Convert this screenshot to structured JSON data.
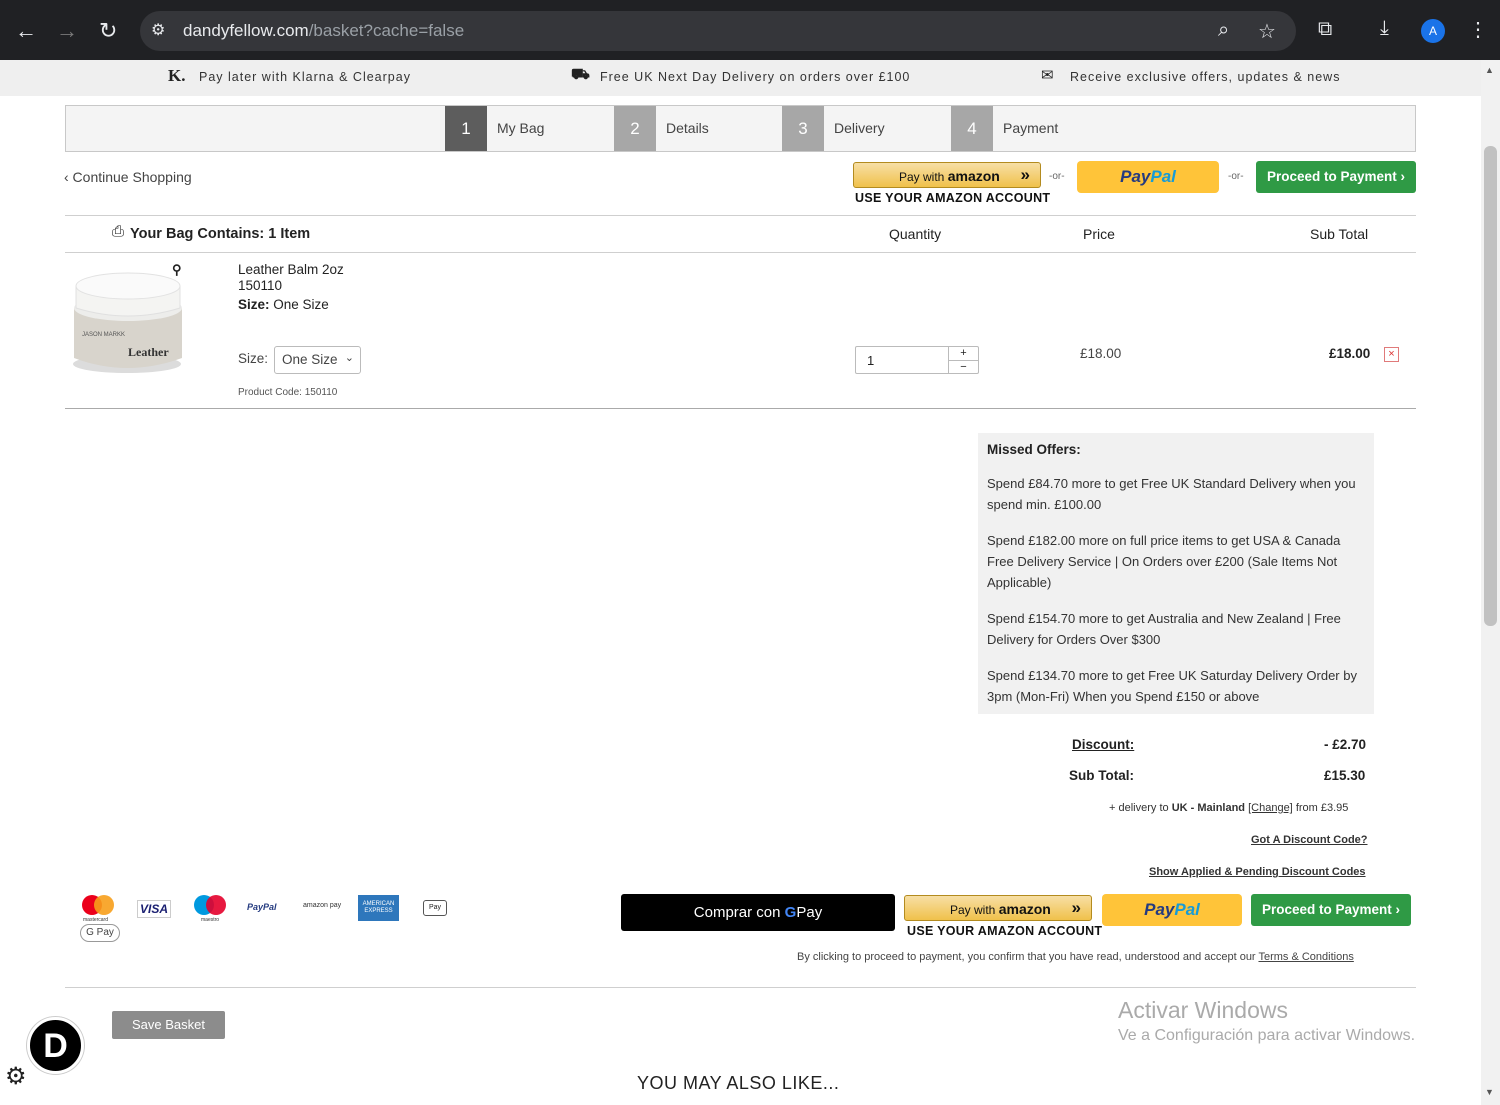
{
  "browser": {
    "url_host": "dandyfellow.com",
    "url_path": "/basket?cache=false",
    "profile_initial": "A"
  },
  "promo": {
    "klarna": "Pay later with Klarna & Clearpay",
    "klarna_icon": "K.",
    "delivery": "Free UK Next Day Delivery on orders over £100",
    "offers": "Receive exclusive offers, updates & news"
  },
  "steps": [
    {
      "num": "1",
      "label": "My Bag"
    },
    {
      "num": "2",
      "label": "Details"
    },
    {
      "num": "3",
      "label": "Delivery"
    },
    {
      "num": "4",
      "label": "Payment"
    }
  ],
  "top_actions": {
    "continue": "‹ Continue Shopping",
    "amazon_pay": "Pay with",
    "amazon_word": "amazon",
    "amazon_sub": "USE YOUR AMAZON ACCOUNT",
    "or": "-or-",
    "paypal_a": "Pay",
    "paypal_b": "Pal",
    "proceed": "Proceed to Payment ›"
  },
  "table": {
    "bag_contains": "Your Bag Contains: 1 Item",
    "quantity": "Quantity",
    "price": "Price",
    "subtotal": "Sub Total"
  },
  "product": {
    "name": "Leather Balm 2oz",
    "sku": "150110",
    "size_label": "Size:",
    "size_value": "One Size",
    "size_select_label": "Size:",
    "size_option": "One Size",
    "code": "Product Code: 150110",
    "qty": "1",
    "price": "£18.00",
    "subtotal": "£18.00",
    "jar_brand": "JASON MARKK",
    "jar_text": "Leather"
  },
  "offers": {
    "heading": "Missed Offers:",
    "items": [
      "Spend £84.70 more to get Free UK Standard Delivery when you spend min. £100.00",
      "Spend £182.00 more on full price items to get USA & Canada Free Delivery Service | On Orders over £200 (Sale Items Not Applicable)",
      "Spend £154.70 more to get Australia and New Zealand | Free Delivery for Orders Over $300",
      "Spend £134.70 more to get Free UK Saturday Delivery Order by 3pm (Mon-Fri) When you Spend £150 or above"
    ]
  },
  "totals": {
    "discount_label": "Discount:",
    "discount_value": "- £2.70",
    "subtotal_label": "Sub Total:",
    "subtotal_value": "£15.30",
    "delivery_prefix": "+ delivery to",
    "delivery_region": "UK - Mainland",
    "delivery_change": "[Change]",
    "delivery_from": "from £3.95",
    "discount_code": "Got A Discount Code?",
    "show_codes": "Show Applied & Pending Discount Codes"
  },
  "bottom_actions": {
    "gpay": "Comprar con",
    "gpay_g": "G",
    "gpay_pay": "Pay",
    "terms_text": "By clicking to proceed to payment, you confirm that you have read, understood and accept our",
    "terms_link": "Terms & Conditions",
    "save": "Save Basket",
    "also_like": "YOU MAY ALSO LIKE..."
  },
  "payment_logos": {
    "visa": "VISA",
    "mastercard": "mastercard",
    "maestro": "maestro",
    "paypal": "PayPal",
    "amazonpay": "amazon pay",
    "amex": "AMERICAN EXPRESS",
    "applepay": "Pay",
    "gpay": "G Pay"
  },
  "windows": {
    "line1": "Activar Windows",
    "line2": "Ve a Configuración para activar Windows."
  },
  "widget": {
    "letter": "D"
  }
}
